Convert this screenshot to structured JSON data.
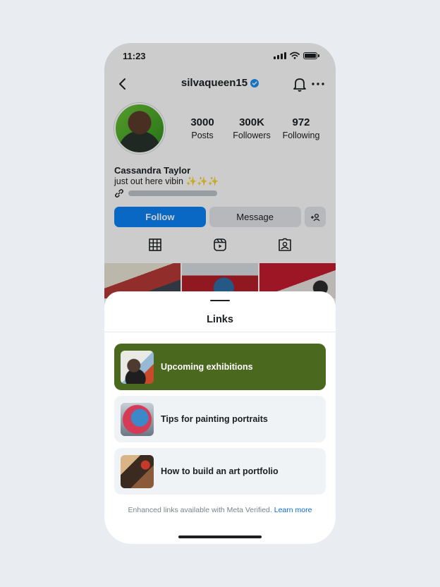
{
  "status_bar": {
    "time": "11:23"
  },
  "header": {
    "username": "silvaqueen15"
  },
  "profile": {
    "stats": [
      {
        "value": "3000",
        "label": "Posts"
      },
      {
        "value": "300K",
        "label": "Followers"
      },
      {
        "value": "972",
        "label": "Following"
      }
    ],
    "name": "Cassandra Taylor",
    "bio": "just out here vibin ✨✨✨"
  },
  "actions": {
    "follow_label": "Follow",
    "message_label": "Message"
  },
  "sheet": {
    "title": "Links",
    "links": [
      {
        "label": "Upcoming exhibitions"
      },
      {
        "label": "Tips for painting portraits"
      },
      {
        "label": "How to build an art portfolio"
      }
    ],
    "footer_text": "Enhanced links available with Meta Verified.",
    "footer_link": "Learn more"
  },
  "colors": {
    "accent": "#0a82f5",
    "featured_link": "#4b691e",
    "background": "#e9ecf0"
  }
}
